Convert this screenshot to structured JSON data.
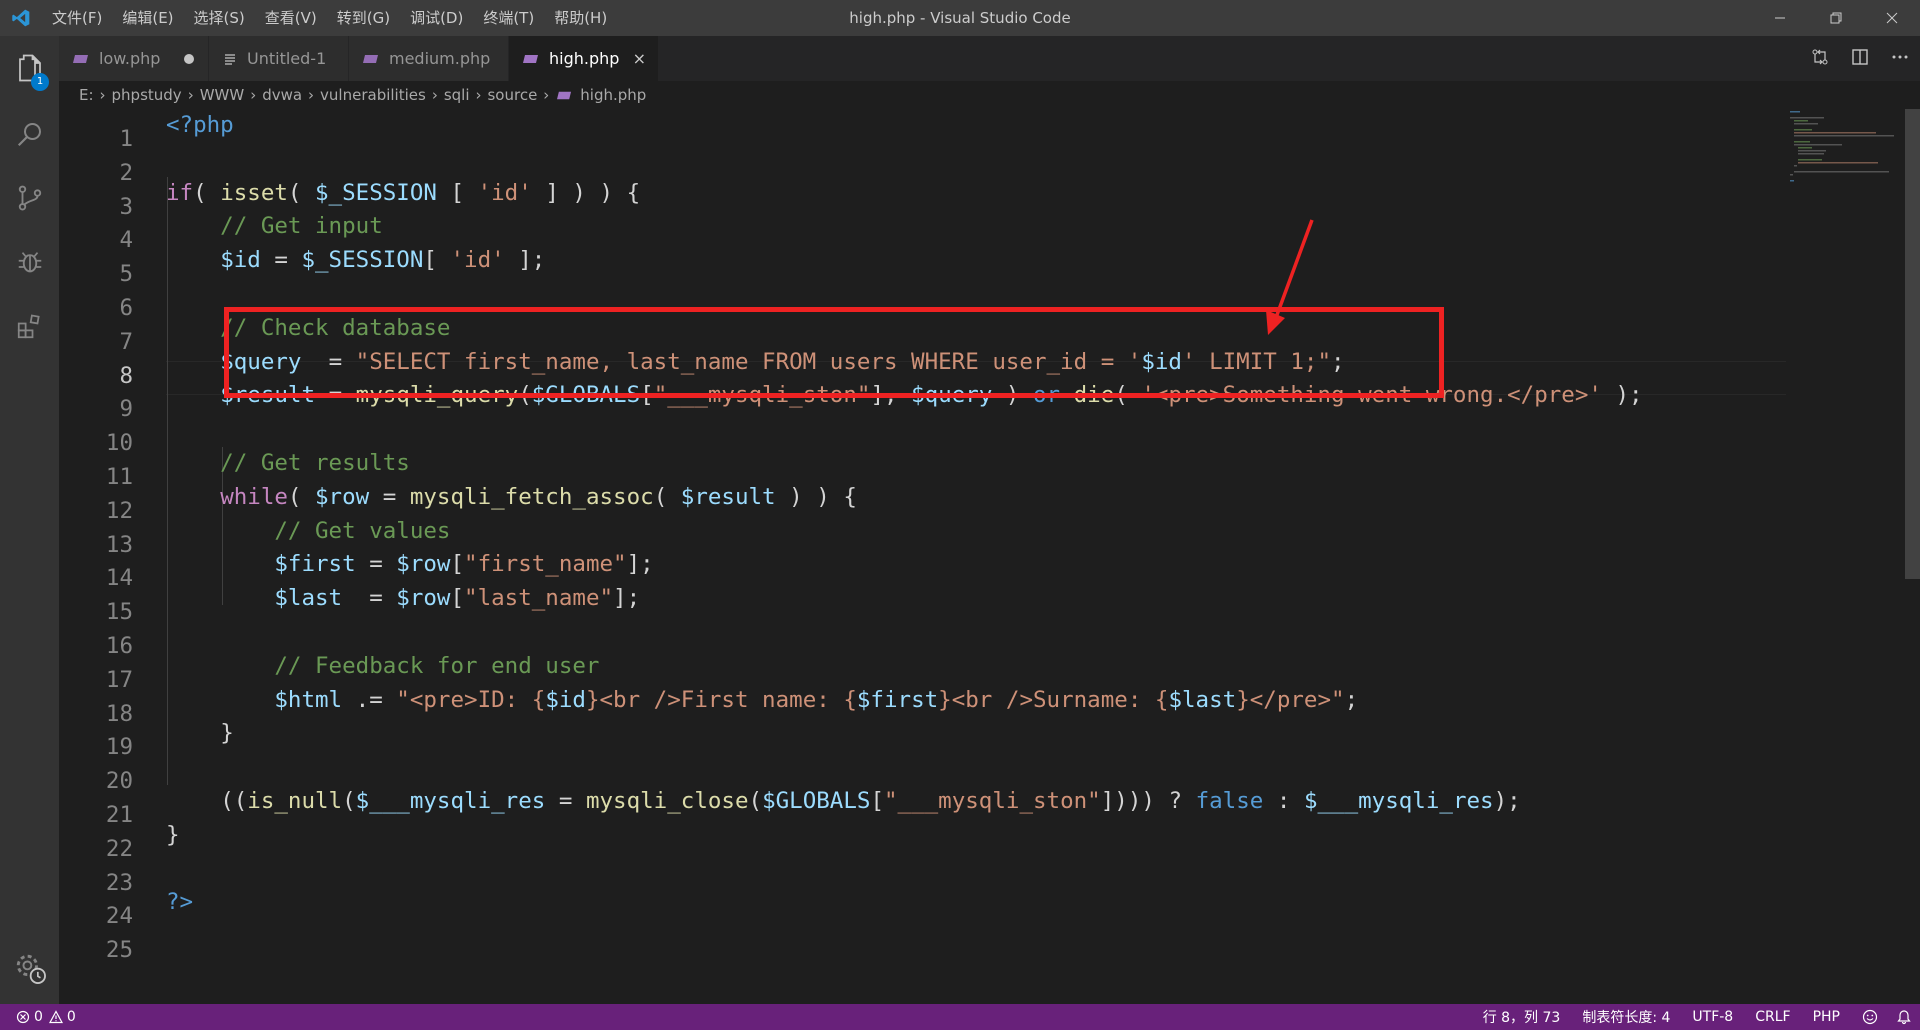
{
  "window": {
    "title": "high.php - Visual Studio Code"
  },
  "menu": [
    "文件(F)",
    "编辑(E)",
    "选择(S)",
    "查看(V)",
    "转到(G)",
    "调试(D)",
    "终端(T)",
    "帮助(H)"
  ],
  "activity_bar": {
    "explorer_badge": "1"
  },
  "tabs": [
    {
      "label": "low.php",
      "icon": "php-icon",
      "modified": true
    },
    {
      "label": "Untitled-1",
      "icon": "text-file-icon",
      "modified": false
    },
    {
      "label": "medium.php",
      "icon": "php-icon",
      "modified": false
    },
    {
      "label": "high.php",
      "icon": "php-icon",
      "active": true,
      "close": "×"
    }
  ],
  "breadcrumb": [
    "E:",
    "phpstudy",
    "WWW",
    "dvwa",
    "vulnerabilities",
    "sqli",
    "source",
    "high.php"
  ],
  "code": {
    "line_numbers": [
      "1",
      "2",
      "3",
      "4",
      "5",
      "6",
      "7",
      "8",
      "9",
      "10",
      "11",
      "12",
      "13",
      "14",
      "15",
      "16",
      "17",
      "18",
      "19",
      "20",
      "21",
      "22",
      "23",
      "24",
      "25"
    ],
    "current_line": 8,
    "lines": [
      "<?php",
      "",
      "if( isset( $_SESSION [ 'id' ] ) ) {",
      "    // Get input",
      "    $id = $_SESSION[ 'id' ];",
      "",
      "    // Check database",
      "    $query  = \"SELECT first_name, last_name FROM users WHERE user_id = '$id' LIMIT 1;\";",
      "    $result = mysqli_query($GLOBALS[\"___mysqli_ston\"], $query ) or die( '<pre>Something went wrong.</pre>' );",
      "",
      "    // Get results",
      "    while( $row = mysqli_fetch_assoc( $result ) ) {",
      "        // Get values",
      "        $first = $row[\"first_name\"];",
      "        $last  = $row[\"last_name\"];",
      "",
      "        // Feedback for end user",
      "        $html .= \"<pre>ID: {$id}<br />First name: {$first}<br />Surname: {$last}</pre>\";",
      "    }",
      "",
      "    ((is_null($___mysqli_res = mysqli_close($GLOBALS[\"___mysqli_ston\"]))) ? false : $___mysqli_res);",
      "}",
      "",
      "?>",
      ""
    ]
  },
  "status": {
    "errors": "0",
    "warnings": "0",
    "cursor": "行 8，列 73",
    "tab_size": "制表符长度: 4",
    "encoding": "UTF-8",
    "eol": "CRLF",
    "language": "PHP"
  },
  "colors": {
    "statusbar": "#68217a",
    "annotation": "#ee2222",
    "accent": "#007acc"
  }
}
